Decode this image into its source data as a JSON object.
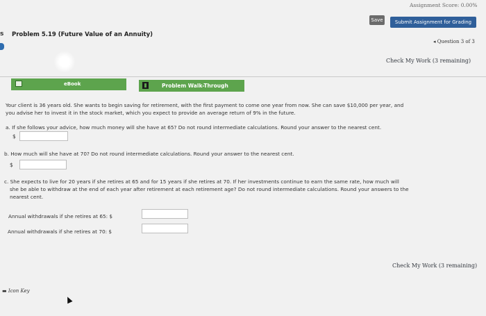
{
  "header": {
    "assignment_score": "Assignment Score: 0.00%",
    "save_label": "Save",
    "submit_label": "Submit Assignment for Grading"
  },
  "problem": {
    "section_mark": "s",
    "title": "Problem 5.19 (Future Value of an Annuity)",
    "question_nav": "◂ Question 3 of 3",
    "check_work_top": "Check My Work (3 remaining)",
    "check_work_bottom": "Check My Work (3 remaining)"
  },
  "tabs": {
    "ebook_label": "eBook",
    "walkthrough_label": "Problem Walk-Through"
  },
  "content": {
    "intro_line1": "Your client is 36 years old. She wants to begin saving for retirement, with the first payment to come one year from now. She can save $10,000 per year, and",
    "intro_line2": "you advise her to invest it in the stock market, which you expect to provide an average return of 9% in the future.",
    "q_a": "a. If she follows your advice, how much money will she have at 65? Do not round intermediate calculations. Round your answer to the nearest cent.",
    "q_b": "b. How much will she have at 70? Do not round intermediate calculations. Round your answer to the nearest cent.",
    "q_c_line1": "c. She expects to live for 20 years if she retires at 65 and for 15 years if she retires at 70. If her investments continue to earn the same rate, how much will",
    "q_c_line2": "she be able to withdraw at the end of each year after retirement at each retirement age? Do not round intermediate calculations. Round your answers to the",
    "q_c_line3": "nearest cent.",
    "dollar_sign": "$",
    "label_65": "Annual withdrawals if she retires at 65: $",
    "label_70": "Annual withdrawals if she retires at 70: $",
    "answer_a": "",
    "answer_b": "",
    "answer_65": "",
    "answer_70": ""
  },
  "footer": {
    "icon_key": "Icon Key"
  },
  "colors": {
    "tab_green": "#5da44d",
    "submit_blue": "#2f5f9a",
    "save_gray": "#6b6b6b"
  }
}
